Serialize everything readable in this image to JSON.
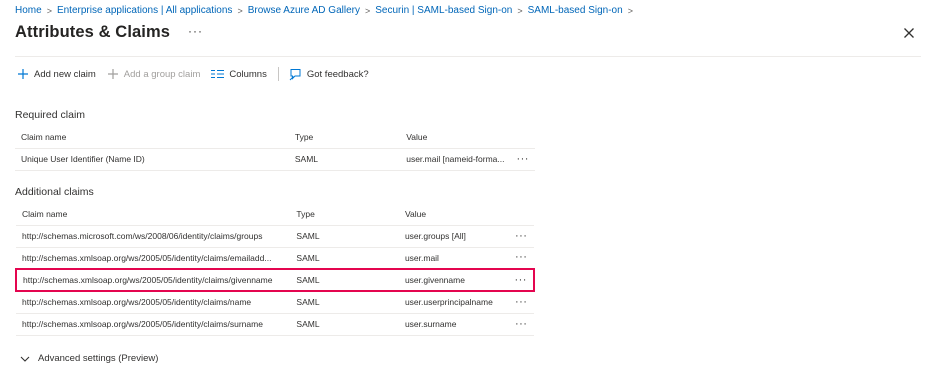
{
  "breadcrumb": {
    "items": [
      "Home",
      "Enterprise applications | All applications",
      "Browse Azure AD Gallery",
      "Securin | SAML-based Sign-on",
      "SAML-based Sign-on"
    ],
    "separator": ">"
  },
  "header": {
    "title": "Attributes & Claims",
    "more": "···"
  },
  "toolbar": {
    "add_new_claim": "Add new claim",
    "add_group_claim": "Add a group claim",
    "columns": "Columns",
    "feedback": "Got feedback?"
  },
  "required": {
    "title": "Required claim",
    "columns": {
      "name": "Claim name",
      "type": "Type",
      "value": "Value"
    },
    "rows": [
      {
        "name": "Unique User Identifier (Name ID)",
        "type": "SAML",
        "value": "user.mail [nameid-forma..."
      }
    ]
  },
  "additional": {
    "title": "Additional claims",
    "columns": {
      "name": "Claim name",
      "type": "Type",
      "value": "Value"
    },
    "rows": [
      {
        "name": "http://schemas.microsoft.com/ws/2008/06/identity/claims/groups",
        "type": "SAML",
        "value": "user.groups [All]"
      },
      {
        "name": "http://schemas.xmlsoap.org/ws/2005/05/identity/claims/emailadd...",
        "type": "SAML",
        "value": "user.mail"
      },
      {
        "name": "http://schemas.xmlsoap.org/ws/2005/05/identity/claims/givenname",
        "type": "SAML",
        "value": "user.givenname"
      },
      {
        "name": "http://schemas.xmlsoap.org/ws/2005/05/identity/claims/name",
        "type": "SAML",
        "value": "user.userprincipalname"
      },
      {
        "name": "http://schemas.xmlsoap.org/ws/2005/05/identity/claims/surname",
        "type": "SAML",
        "value": "user.surname"
      }
    ],
    "highlighted_row": 2
  },
  "row_action": "···",
  "advanced": {
    "label": "Advanced settings (Preview)"
  },
  "colors": {
    "link": "#0066b8",
    "highlight": "#e4054f",
    "icon": "#0078d4"
  }
}
